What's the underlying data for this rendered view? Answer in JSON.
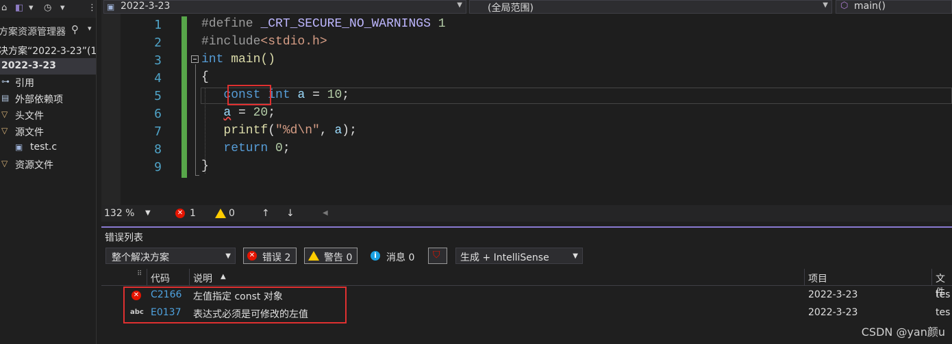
{
  "sidebar": {
    "header": "方案资源管理器",
    "solution": "决方案“2022-3-23”(1",
    "project": "2022-3-23",
    "items": [
      {
        "label": "引用",
        "icon": "references-icon"
      },
      {
        "label": "外部依赖项",
        "icon": "external-deps-icon"
      },
      {
        "label": "头文件",
        "icon": "filter-folder-icon"
      },
      {
        "label": "源文件",
        "icon": "filter-folder-icon"
      },
      {
        "label": "test.c",
        "icon": "c-file-icon"
      },
      {
        "label": "资源文件",
        "icon": "filter-folder-icon"
      }
    ]
  },
  "topbar": {
    "project_dropdown": "2022-3-23",
    "scope_dropdown": "(全局范围)",
    "member_dropdown": "main()"
  },
  "editor": {
    "line_numbers": [
      "1",
      "2",
      "3",
      "4",
      "5",
      "6",
      "7",
      "8",
      "9"
    ],
    "l1": {
      "kw": "#define",
      "macro": "_CRT_SECURE_NO_WARNINGS",
      "num": "1"
    },
    "l2": {
      "kw": "#include",
      "hdr": "<stdio.h>"
    },
    "l3": {
      "kw": "int",
      "rest": " main()"
    },
    "l4": "{",
    "l5": {
      "const": "const",
      "int": "int",
      "var": "a",
      "eq": " = ",
      "num": "10",
      "semi": ";"
    },
    "l6": {
      "var": "a",
      "eq": " = ",
      "num": "20",
      "semi": ";"
    },
    "l7": {
      "fn": "printf",
      "open": "(",
      "str": "\"%d\\n\"",
      "mid": ", ",
      "var": "a",
      "close": ");"
    },
    "l8": {
      "kw": "return",
      "num": "0",
      "semi": ";"
    },
    "l9": "}"
  },
  "editor_status": {
    "zoom": "132 %",
    "errors": "1",
    "warnings": "0"
  },
  "error_list": {
    "title": "错误列表",
    "scope": "整个解决方案",
    "errors_btn": "错误 2",
    "warnings_btn": "警告 0",
    "messages_btn": "消息 0",
    "source": "生成 + IntelliSense",
    "columns": {
      "code": "代码",
      "desc": "说明",
      "project": "项目",
      "file": "文件"
    },
    "rows": [
      {
        "code": "C2166",
        "desc": "左值指定 const 对象",
        "project": "2022-3-23",
        "file": "tes"
      },
      {
        "code": "E0137",
        "desc": "表达式必须是可修改的左值",
        "project": "2022-3-23",
        "file": "tes"
      }
    ]
  },
  "watermark": "CSDN @yan颜u",
  "colors": {
    "accent": "#8a7ad2",
    "error": "#e51400",
    "highlight_box": "#e03030",
    "change_bar": "#57a64a"
  }
}
